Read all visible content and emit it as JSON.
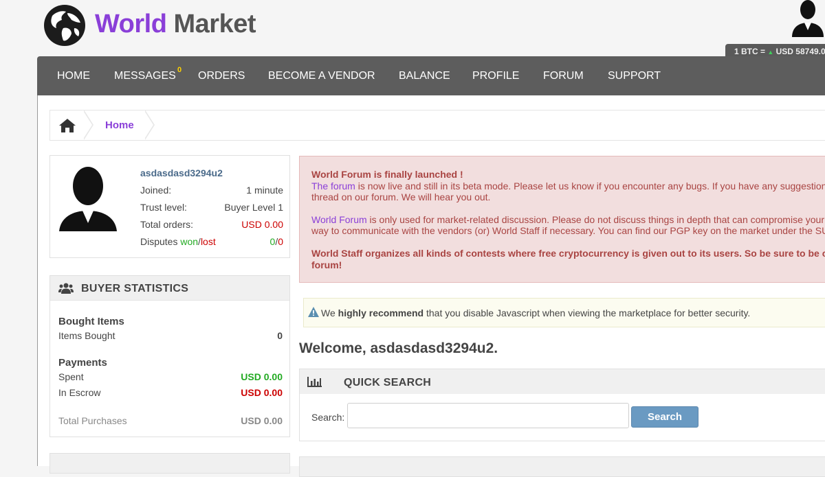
{
  "brand": {
    "word1": "World",
    "word2": "Market"
  },
  "btc_rate": {
    "prefix": "1 BTC = ",
    "value": "USD 58749.0"
  },
  "nav": [
    {
      "label": "HOME"
    },
    {
      "label": "MESSAGES",
      "badge": "0"
    },
    {
      "label": "ORDERS"
    },
    {
      "label": "BECOME A VENDOR"
    },
    {
      "label": "BALANCE"
    },
    {
      "label": "PROFILE"
    },
    {
      "label": "FORUM"
    },
    {
      "label": "SUPPORT"
    }
  ],
  "breadcrumb": {
    "current": "Home"
  },
  "profile": {
    "username": "asdasdasd3294u2",
    "joined_label": "Joined:",
    "joined_value": "1 minute",
    "trust_label": "Trust level:",
    "trust_value": "Buyer Level 1",
    "orders_label": "Total orders:",
    "orders_value": "USD 0.00",
    "disputes_label": "Disputes",
    "disputes_won": "won",
    "disputes_slash": "/",
    "disputes_lost": "lost",
    "disputes_won_value": "0",
    "disputes_lost_value": "0"
  },
  "buyer_stats": {
    "title": "BUYER STATISTICS",
    "bought_heading": "Bought Items",
    "items_bought_label": "Items Bought",
    "items_bought_value": "0",
    "payments_heading": "Payments",
    "spent_label": "Spent",
    "spent_value": "USD 0.00",
    "escrow_label": "In Escrow",
    "escrow_value": "USD 0.00",
    "total_label": "Total Purchases",
    "total_value": "USD 0.00"
  },
  "alert": {
    "title": "World Forum is finally launched !",
    "l1_link": "The forum",
    "l1_rest": " is now live and still in its beta mode. Please let us know if you encounter any bugs. If you have any suggestions, please create a",
    "l2": "thread on our forum. We will hear you out.",
    "l3_link": "World Forum",
    "l3_rest": " is only used for market-related discussion. Please do not discuss things in depth that can compromise your OPSEC. It is also a",
    "l4": "way to communicate with the vendors (or) World Staff if necessary. You can find our PGP key on the market under the SUPPORT section.",
    "l5": "World Staff organizes all kinds of contests where free cryptocurrency is given out to its users. So be sure to be on the lookout on the",
    "l6": "forum!"
  },
  "warning": {
    "pre": "We ",
    "strong": "highly recommend",
    "post": " that you disable Javascript when viewing the marketplace for better security."
  },
  "welcome": "Welcome, asdasdasd3294u2.",
  "quick_search": {
    "title": "QUICK SEARCH",
    "label": "Search:",
    "input_value": "",
    "button": "Search"
  },
  "colors": {
    "accent": "#8a3fd8",
    "nav_bg": "#5d5d5d",
    "green": "#22aa22",
    "red": "#cc0000",
    "button": "#6a9ac2"
  }
}
